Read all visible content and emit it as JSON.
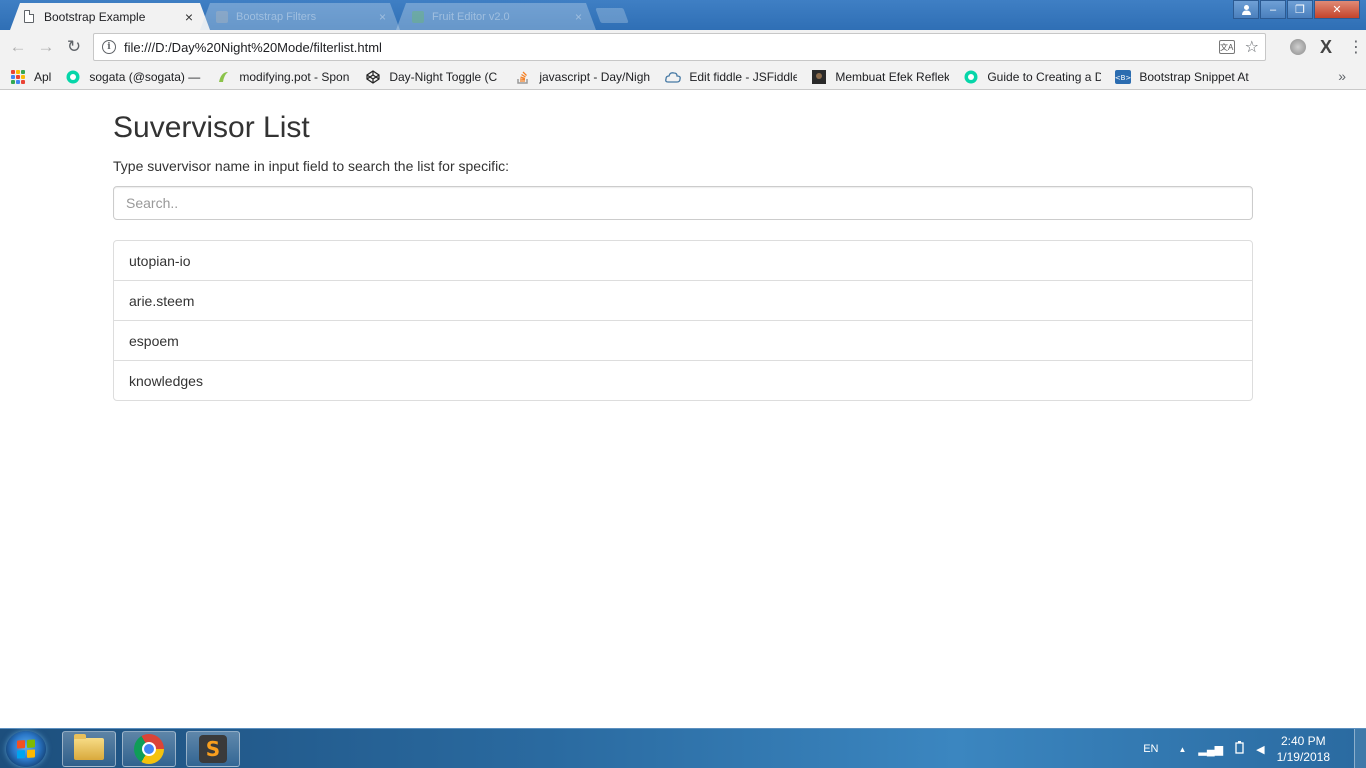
{
  "browser": {
    "active_tab": {
      "title": "Bootstrap Example",
      "close_icon": "×"
    },
    "background_tabs": [
      {
        "title": "Bootstrap Filters",
        "close_icon": "×"
      },
      {
        "title": "Fruit Editor v2.0",
        "close_icon": "×"
      }
    ],
    "window_controls": {
      "minimize": "–",
      "restore": "❐",
      "close": "✕"
    },
    "toolbar": {
      "back": "←",
      "forward": "→",
      "reload": "↻",
      "url": "file:///D:/Day%20Night%20Mode/filterlist.html",
      "info": "i",
      "translate": "文A",
      "star": "☆",
      "extension_x": "X",
      "menu": "⋮"
    },
    "bookmarks": [
      {
        "label": "Apl"
      },
      {
        "label": "sogata (@sogata) — S"
      },
      {
        "label": "modifying.pot - Spon"
      },
      {
        "label": "Day-Night Toggle (C"
      },
      {
        "label": "javascript - Day/Nigh"
      },
      {
        "label": "Edit fiddle - JSFiddle"
      },
      {
        "label": "Membuat Efek Reflek"
      },
      {
        "label": "Guide to Creating a D"
      },
      {
        "label": "Bootstrap Snippet At"
      }
    ],
    "bookmarks_more": "»"
  },
  "page": {
    "title": "Suvervisor List",
    "subtitle": "Type suvervisor name in input field to search the list for specific:",
    "search": {
      "placeholder": "Search..",
      "value": ""
    },
    "items": [
      "utopian-io",
      "arie.steem",
      "espoem",
      "knowledges"
    ]
  },
  "taskbar": {
    "language": "EN",
    "tray_arrow": "▲",
    "signal": "▂▄▆",
    "volume": "◀",
    "time": "2:40 PM",
    "date": "1/19/2018"
  }
}
